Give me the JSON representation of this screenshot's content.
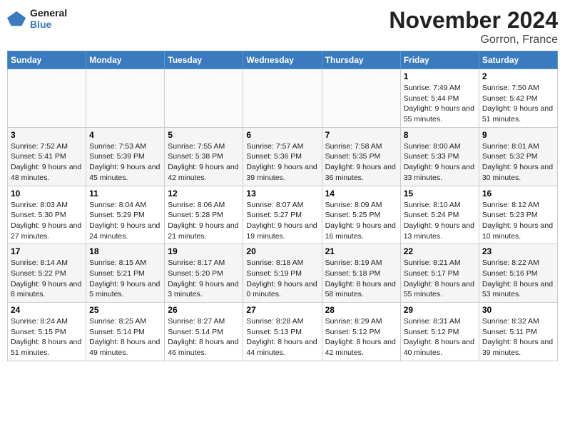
{
  "header": {
    "logo_line1": "General",
    "logo_line2": "Blue",
    "month_title": "November 2024",
    "location": "Gorron, France"
  },
  "days_of_week": [
    "Sunday",
    "Monday",
    "Tuesday",
    "Wednesday",
    "Thursday",
    "Friday",
    "Saturday"
  ],
  "weeks": [
    [
      {
        "day": "",
        "info": ""
      },
      {
        "day": "",
        "info": ""
      },
      {
        "day": "",
        "info": ""
      },
      {
        "day": "",
        "info": ""
      },
      {
        "day": "",
        "info": ""
      },
      {
        "day": "1",
        "info": "Sunrise: 7:49 AM\nSunset: 5:44 PM\nDaylight: 9 hours and 55 minutes."
      },
      {
        "day": "2",
        "info": "Sunrise: 7:50 AM\nSunset: 5:42 PM\nDaylight: 9 hours and 51 minutes."
      }
    ],
    [
      {
        "day": "3",
        "info": "Sunrise: 7:52 AM\nSunset: 5:41 PM\nDaylight: 9 hours and 48 minutes."
      },
      {
        "day": "4",
        "info": "Sunrise: 7:53 AM\nSunset: 5:39 PM\nDaylight: 9 hours and 45 minutes."
      },
      {
        "day": "5",
        "info": "Sunrise: 7:55 AM\nSunset: 5:38 PM\nDaylight: 9 hours and 42 minutes."
      },
      {
        "day": "6",
        "info": "Sunrise: 7:57 AM\nSunset: 5:36 PM\nDaylight: 9 hours and 39 minutes."
      },
      {
        "day": "7",
        "info": "Sunrise: 7:58 AM\nSunset: 5:35 PM\nDaylight: 9 hours and 36 minutes."
      },
      {
        "day": "8",
        "info": "Sunrise: 8:00 AM\nSunset: 5:33 PM\nDaylight: 9 hours and 33 minutes."
      },
      {
        "day": "9",
        "info": "Sunrise: 8:01 AM\nSunset: 5:32 PM\nDaylight: 9 hours and 30 minutes."
      }
    ],
    [
      {
        "day": "10",
        "info": "Sunrise: 8:03 AM\nSunset: 5:30 PM\nDaylight: 9 hours and 27 minutes."
      },
      {
        "day": "11",
        "info": "Sunrise: 8:04 AM\nSunset: 5:29 PM\nDaylight: 9 hours and 24 minutes."
      },
      {
        "day": "12",
        "info": "Sunrise: 8:06 AM\nSunset: 5:28 PM\nDaylight: 9 hours and 21 minutes."
      },
      {
        "day": "13",
        "info": "Sunrise: 8:07 AM\nSunset: 5:27 PM\nDaylight: 9 hours and 19 minutes."
      },
      {
        "day": "14",
        "info": "Sunrise: 8:09 AM\nSunset: 5:25 PM\nDaylight: 9 hours and 16 minutes."
      },
      {
        "day": "15",
        "info": "Sunrise: 8:10 AM\nSunset: 5:24 PM\nDaylight: 9 hours and 13 minutes."
      },
      {
        "day": "16",
        "info": "Sunrise: 8:12 AM\nSunset: 5:23 PM\nDaylight: 9 hours and 10 minutes."
      }
    ],
    [
      {
        "day": "17",
        "info": "Sunrise: 8:14 AM\nSunset: 5:22 PM\nDaylight: 9 hours and 8 minutes."
      },
      {
        "day": "18",
        "info": "Sunrise: 8:15 AM\nSunset: 5:21 PM\nDaylight: 9 hours and 5 minutes."
      },
      {
        "day": "19",
        "info": "Sunrise: 8:17 AM\nSunset: 5:20 PM\nDaylight: 9 hours and 3 minutes."
      },
      {
        "day": "20",
        "info": "Sunrise: 8:18 AM\nSunset: 5:19 PM\nDaylight: 9 hours and 0 minutes."
      },
      {
        "day": "21",
        "info": "Sunrise: 8:19 AM\nSunset: 5:18 PM\nDaylight: 8 hours and 58 minutes."
      },
      {
        "day": "22",
        "info": "Sunrise: 8:21 AM\nSunset: 5:17 PM\nDaylight: 8 hours and 55 minutes."
      },
      {
        "day": "23",
        "info": "Sunrise: 8:22 AM\nSunset: 5:16 PM\nDaylight: 8 hours and 53 minutes."
      }
    ],
    [
      {
        "day": "24",
        "info": "Sunrise: 8:24 AM\nSunset: 5:15 PM\nDaylight: 8 hours and 51 minutes."
      },
      {
        "day": "25",
        "info": "Sunrise: 8:25 AM\nSunset: 5:14 PM\nDaylight: 8 hours and 49 minutes."
      },
      {
        "day": "26",
        "info": "Sunrise: 8:27 AM\nSunset: 5:14 PM\nDaylight: 8 hours and 46 minutes."
      },
      {
        "day": "27",
        "info": "Sunrise: 8:28 AM\nSunset: 5:13 PM\nDaylight: 8 hours and 44 minutes."
      },
      {
        "day": "28",
        "info": "Sunrise: 8:29 AM\nSunset: 5:12 PM\nDaylight: 8 hours and 42 minutes."
      },
      {
        "day": "29",
        "info": "Sunrise: 8:31 AM\nSunset: 5:12 PM\nDaylight: 8 hours and 40 minutes."
      },
      {
        "day": "30",
        "info": "Sunrise: 8:32 AM\nSunset: 5:11 PM\nDaylight: 8 hours and 39 minutes."
      }
    ]
  ]
}
